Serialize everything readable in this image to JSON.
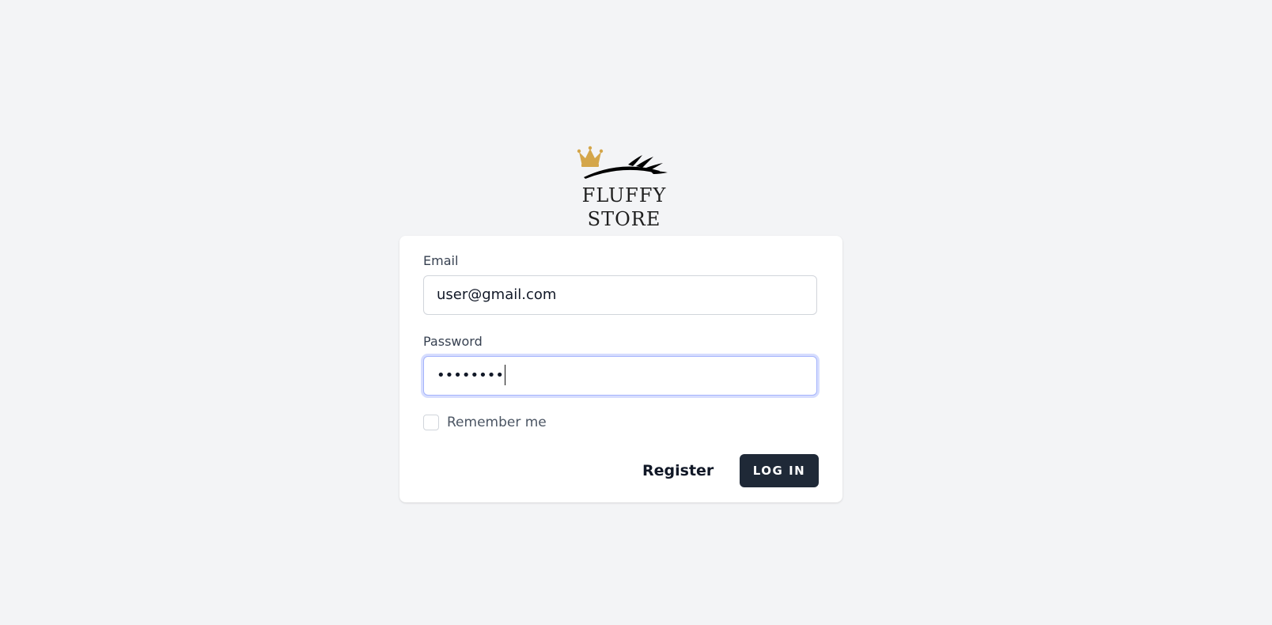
{
  "logo": {
    "text": "FLUFFY STORE",
    "icon": "crown-eyelash-icon",
    "crown_color": "#d4a64a",
    "lash_color": "#000000"
  },
  "form": {
    "email_label": "Email",
    "email_value": "user@gmail.com",
    "password_label": "Password",
    "password_value": "••••••••",
    "remember_label": "Remember me",
    "register_label": "Register",
    "login_label": "LOG IN"
  },
  "colors": {
    "background": "#f3f4f6",
    "button": "#1f2937",
    "focus_ring": "#a5b4fc"
  }
}
